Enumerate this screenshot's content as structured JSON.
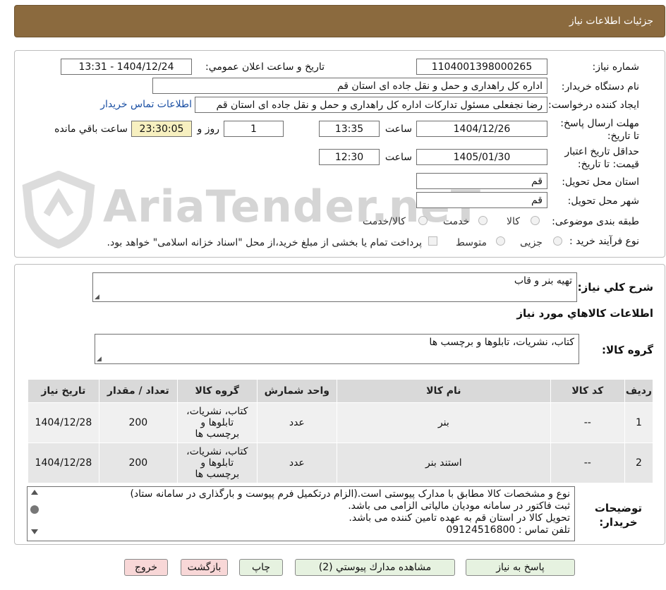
{
  "header": {
    "title": "جزئیات اطلاعات نیاز"
  },
  "watermark": {
    "text": "AriaTender.neT"
  },
  "form": {
    "need_number": {
      "label": "شماره نیاز:",
      "value": "1104001398000265"
    },
    "announce": {
      "label": "تاریخ و ساعت اعلان عمومي:",
      "value": "1404/12/24 - 13:31"
    },
    "buyer_org": {
      "label": "نام دستگاه خریدار:",
      "value": "اداره کل راهداری و حمل و نقل جاده ای استان قم"
    },
    "requester": {
      "label": "ایجاد کننده درخواست:",
      "value": "رضا  نجفعلی مسئول تدارکات اداره کل راهداری و حمل و نقل جاده ای استان قم",
      "contact_link": "اطلاعات تماس خریدار"
    },
    "deadline": {
      "label": "مهلت ارسال پاسخ: تا تاریخ:",
      "date": "1404/12/26",
      "time_label": "ساعت",
      "time": "13:35",
      "days": "1",
      "days_label": "روز و",
      "remaining": "23:30:05",
      "remaining_label": "ساعت باقي مانده"
    },
    "validity": {
      "label": "حداقل تاریخ اعتبار قیمت: تا تاریخ:",
      "date": "1405/01/30",
      "time_label": "ساعت",
      "time": "12:30"
    },
    "province": {
      "label": "استان محل تحویل:",
      "value": "قم"
    },
    "city": {
      "label": "شهر محل تحویل:",
      "value": "قم"
    },
    "category": {
      "label": "طبقه بندی موضوعی:",
      "options": [
        "کالا",
        "خدمت",
        "کالا/خدمت"
      ]
    },
    "process": {
      "label": "نوع فرآیند خرید :",
      "options": [
        "جزیی",
        "متوسط"
      ],
      "note": "پرداخت تمام یا بخشی از مبلغ خرید،از محل \"اسناد خزانه اسلامی\" خواهد بود."
    }
  },
  "summary": {
    "label": "شرح كلي نياز:",
    "value": "تهیه بنر و قاب",
    "items_title": "اطلاعات كالاهاي مورد نياز",
    "group_label": "گروه كالا:",
    "group_value": "کتاب، نشریات، تابلوها و برچسب ها"
  },
  "table": {
    "headers": [
      "رديف",
      "كد كالا",
      "نام كالا",
      "واحد شمارش",
      "گروه كالا",
      "تعداد / مقدار",
      "تاريخ نياز"
    ],
    "rows": [
      [
        "1",
        "--",
        "بنر",
        "عدد",
        "کتاب، نشریات، تابلوها و برچسب ها",
        "200",
        "1404/12/28"
      ],
      [
        "2",
        "--",
        "استند بنر",
        "عدد",
        "کتاب، نشریات، تابلوها و برچسب ها",
        "200",
        "1404/12/28"
      ]
    ]
  },
  "notes": {
    "label_line1": "توضيحات",
    "label_line2": "خريدار:",
    "lines": [
      "نوع و مشخصات کالا مطابق با مدارک پیوستی است.(الزام درتکمیل فرم پیوست و بارگذاری در سامانه ستاد)",
      "ثبت فاکتور در سامانه مودیان مالیاتی الزامی می باشد.",
      "تحویل کالا در استان قم به عهده تامین کننده می باشد.",
      "تلفن تماس : 09124516800"
    ]
  },
  "buttons": {
    "reply": "پاسخ به نياز",
    "attachments": "مشاهده مدارك پيوستي (2)",
    "print": "چاپ",
    "back": "بازگشت",
    "exit": "خروج"
  }
}
